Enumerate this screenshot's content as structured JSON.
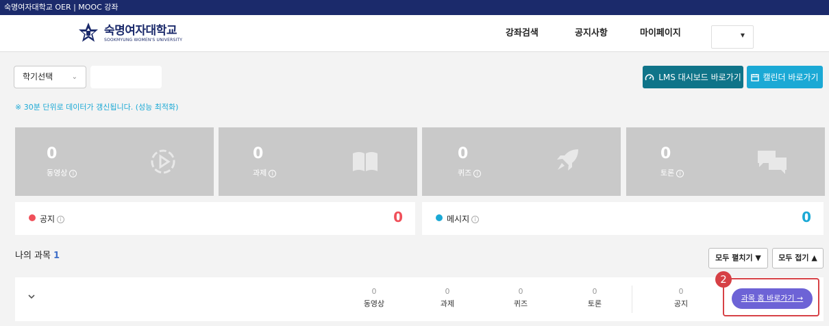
{
  "topbar": {
    "text": "숙명여자대학교 OER | MOOC 강좌"
  },
  "header": {
    "logo_ko": "숙명여자대학교",
    "logo_en": "SOOKMYUNG WOMEN'S UNIVERSITY",
    "nav": [
      "강좌검색",
      "공지사항",
      "마이페이지"
    ]
  },
  "filters": {
    "semester_label": "학기선택",
    "semester_extra": ""
  },
  "buttons": {
    "lms": "LMS 대시보드 바로가기",
    "calendar": "캘린더 바로가기",
    "expand_all": "모두 펼치기 ▼",
    "collapse_all": "모두 접기 ▲",
    "go_course": "과목 홈 바로가기 →"
  },
  "notice": "※ 30분 단위로 데이터가 갱신됩니다. (성능 최적화)",
  "stats": [
    {
      "value": "0",
      "label": "동영상",
      "icon": "play-icon"
    },
    {
      "value": "0",
      "label": "과제",
      "icon": "book-icon"
    },
    {
      "value": "0",
      "label": "퀴즈",
      "icon": "rocket-icon"
    },
    {
      "value": "0",
      "label": "토론",
      "icon": "chat-icon"
    }
  ],
  "messages": [
    {
      "label": "공지",
      "count": "0",
      "color": "#f0505a"
    },
    {
      "label": "메시지",
      "count": "0",
      "color": "#1ba9d5"
    }
  ],
  "my_courses": {
    "label": "나의 과목",
    "count": "1"
  },
  "course_row": {
    "stats": [
      {
        "value": "0",
        "label": "동영상"
      },
      {
        "value": "0",
        "label": "과제"
      },
      {
        "value": "0",
        "label": "퀴즈"
      },
      {
        "value": "0",
        "label": "토론"
      },
      {
        "value": "0",
        "label": "공지"
      }
    ],
    "step_badge": "2"
  },
  "colors": {
    "topbar": "#1b2a6b",
    "lms_button": "#0f7489",
    "calendar_button": "#1ba9d5",
    "stat_tile": "#c9c9c9",
    "go_button": "#6d63d6",
    "highlight": "#d64045"
  }
}
